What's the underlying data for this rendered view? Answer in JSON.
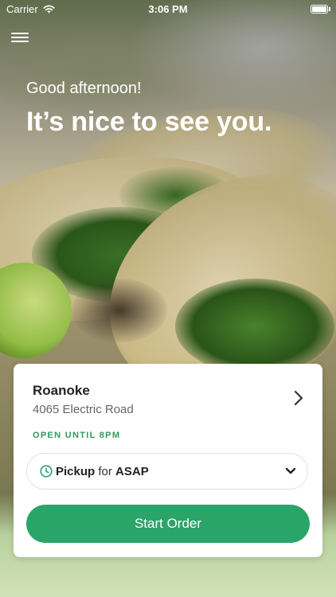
{
  "status_bar": {
    "carrier": "Carrier",
    "time": "3:06 PM",
    "battery_level": 1.0
  },
  "hero": {
    "greeting": "Good afternoon!",
    "headline": "It’s nice to see you."
  },
  "location_card": {
    "name": "Roanoke",
    "address": "4065 Electric Road",
    "status": "OPEN UNTIL 8PM",
    "order_mode": {
      "method": "Pickup",
      "connector": "for",
      "time": "ASAP"
    },
    "cta_label": "Start Order"
  },
  "icons": [
    "wifi-icon",
    "battery-icon",
    "menu-icon",
    "chevron-right-icon",
    "clock-icon",
    "chevron-down-icon"
  ],
  "colors": {
    "accent": "#2aa56a",
    "status_text": "#2e9a5e"
  }
}
